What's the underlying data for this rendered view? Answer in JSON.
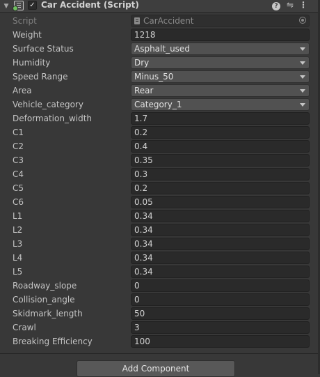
{
  "component": {
    "fold_icon": "triangle-down-icon",
    "script_icon": "cs-script-icon",
    "enabled": true,
    "title": "Car Accident (Script)",
    "help_icon": "help-icon",
    "presets_icon": "sliders-icon",
    "menu_icon": "kebab-menu-icon"
  },
  "script_field": {
    "label": "Script",
    "value": "CarAccident"
  },
  "properties": [
    {
      "label": "Weight",
      "type": "text",
      "value": "1218"
    },
    {
      "label": "Surface Status",
      "type": "dropdown",
      "value": "Asphalt_used"
    },
    {
      "label": "Humidity",
      "type": "dropdown",
      "value": "Dry"
    },
    {
      "label": "Speed Range",
      "type": "dropdown",
      "value": "Minus_50"
    },
    {
      "label": "Area",
      "type": "dropdown",
      "value": "Rear"
    },
    {
      "label": "Vehicle_category",
      "type": "dropdown",
      "value": "Category_1"
    },
    {
      "label": "Deformation_width",
      "type": "text",
      "value": "1.7"
    },
    {
      "label": "C1",
      "type": "text",
      "value": "0.2"
    },
    {
      "label": "C2",
      "type": "text",
      "value": "0.4"
    },
    {
      "label": "C3",
      "type": "text",
      "value": "0.35"
    },
    {
      "label": "C4",
      "type": "text",
      "value": "0.3"
    },
    {
      "label": "C5",
      "type": "text",
      "value": "0.2"
    },
    {
      "label": "C6",
      "type": "text",
      "value": "0.05"
    },
    {
      "label": "L1",
      "type": "text",
      "value": "0.34"
    },
    {
      "label": "L2",
      "type": "text",
      "value": "0.34"
    },
    {
      "label": "L3",
      "type": "text",
      "value": "0.34"
    },
    {
      "label": "L4",
      "type": "text",
      "value": "0.34"
    },
    {
      "label": "L5",
      "type": "text",
      "value": "0.34"
    },
    {
      "label": "Roadway_slope",
      "type": "text",
      "value": "0"
    },
    {
      "label": "Collision_angle",
      "type": "text",
      "value": "0"
    },
    {
      "label": "Skidmark_length",
      "type": "text",
      "value": "50"
    },
    {
      "label": "Crawl",
      "type": "text",
      "value": "3"
    },
    {
      "label": "Breaking Efficiency",
      "type": "text",
      "value": "100"
    }
  ],
  "add_component_label": "Add Component"
}
